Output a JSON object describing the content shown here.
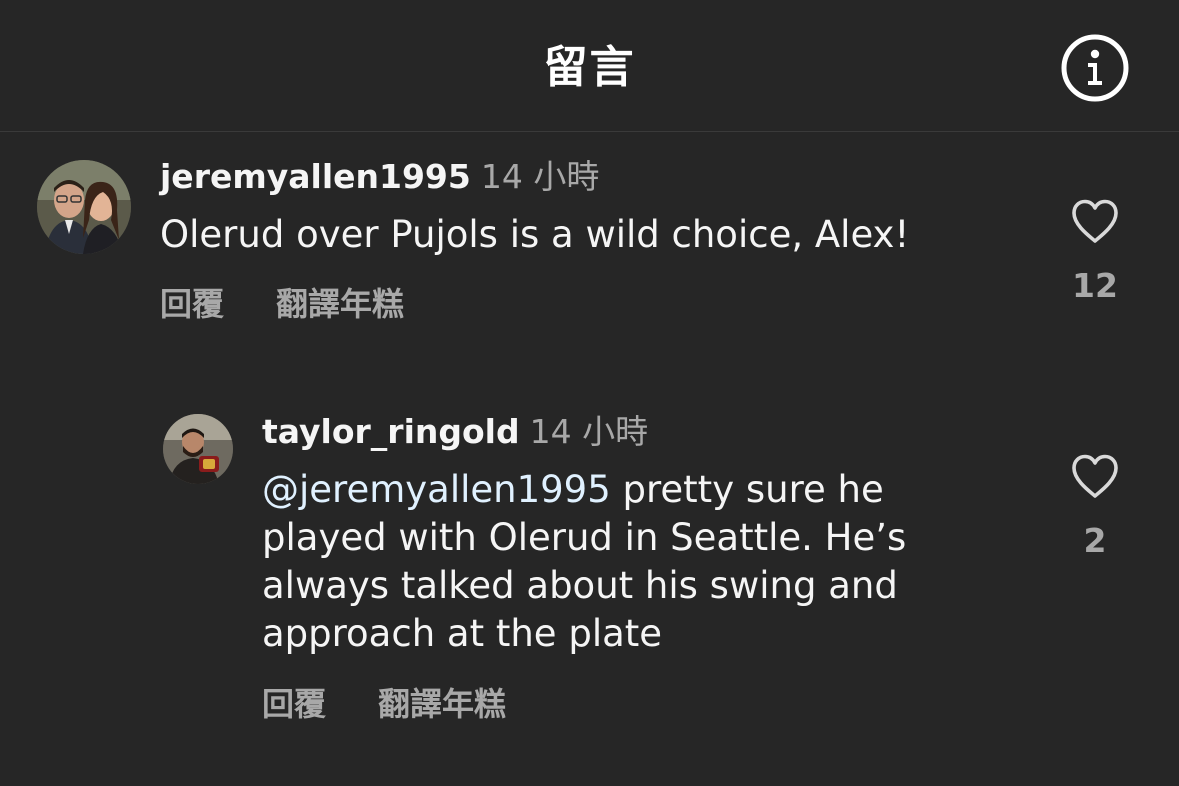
{
  "header": {
    "title": "留言",
    "info_icon": "info-circle-icon"
  },
  "comments": [
    {
      "username": "jeremyallen1995",
      "time": "14 小時",
      "text": "Olerud over Pujols is a wild choice, Alex!",
      "reply_label": "回覆",
      "translate_label": "翻譯年糕",
      "like_count": "12",
      "like_icon": "heart-outline-icon"
    },
    {
      "username": "taylor_ringold",
      "time": "14 小時",
      "mention": "@jeremyallen1995",
      "text": " pretty sure he played with Olerud in Seattle. He’s always talked about his swing and approach at the plate",
      "reply_label": "回覆",
      "translate_label": "翻譯年糕",
      "like_count": "2",
      "like_icon": "heart-outline-icon"
    }
  ],
  "colors": {
    "background": "#262626",
    "primary_text": "#f5f5f5",
    "secondary_text": "#a8a8a8",
    "mention": "#e0f1ff"
  }
}
